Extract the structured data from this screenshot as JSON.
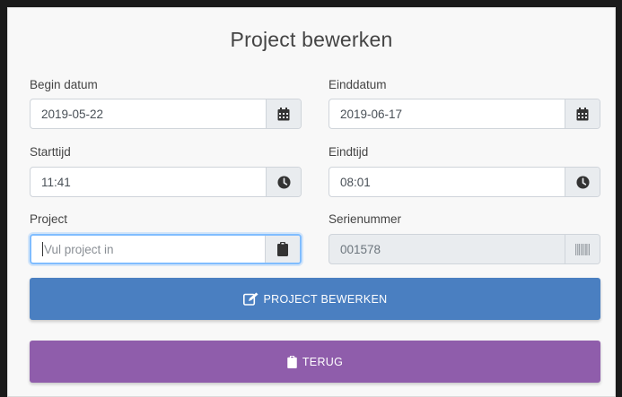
{
  "form": {
    "title": "Project bewerken",
    "begin_date": {
      "label": "Begin datum",
      "value": "2019-05-22",
      "icon": "calendar-icon"
    },
    "end_date": {
      "label": "Einddatum",
      "value": "2019-06-17",
      "icon": "calendar-icon"
    },
    "start_time": {
      "label": "Starttijd",
      "value": "11:41",
      "icon": "clock-icon"
    },
    "end_time": {
      "label": "Eindtijd",
      "value": "08:01",
      "icon": "clock-icon"
    },
    "project": {
      "label": "Project",
      "placeholder": "Vul project in",
      "value": "",
      "icon": "clipboard-icon"
    },
    "serial": {
      "label": "Serienummer",
      "value": "001578",
      "icon": "barcode-icon"
    }
  },
  "buttons": {
    "submit": {
      "label": "PROJECT BEWERKEN",
      "icon": "edit-icon",
      "color": "#4a7fc1"
    },
    "back": {
      "label": "TERUG",
      "icon": "clipboard-icon",
      "color": "#8f5dab"
    }
  }
}
